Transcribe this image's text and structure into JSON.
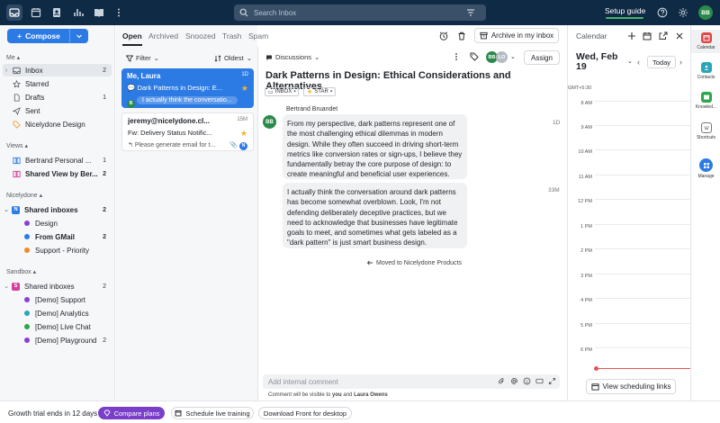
{
  "topbar": {
    "search_placeholder": "Search Inbox",
    "setup_guide": "Setup guide",
    "user_initials": "BB"
  },
  "sidebar": {
    "compose_label": "Compose",
    "me_header": "Me",
    "me_items": [
      {
        "label": "Inbox",
        "count": "2",
        "icon": "inbox-icon"
      },
      {
        "label": "Starred",
        "count": "",
        "icon": "star-icon"
      },
      {
        "label": "Drafts",
        "count": "1",
        "icon": "draft-icon"
      },
      {
        "label": "Sent",
        "count": "",
        "icon": "send-icon"
      },
      {
        "label": "Nicelydone Design",
        "count": "",
        "icon": "tag-icon"
      }
    ],
    "views_header": "Views",
    "views_items": [
      {
        "label": "Bertrand Personal ...",
        "count": "1"
      },
      {
        "label": "Shared View by Ber...",
        "count": "2"
      }
    ],
    "team_header": "Nicelydone",
    "team_items": [
      {
        "label": "Shared inboxes",
        "count": "2"
      },
      {
        "label": "Design",
        "count": "",
        "color": "#8b3fd1"
      },
      {
        "label": "From GMail",
        "count": "2",
        "color": "#2c7be5"
      },
      {
        "label": "Support - Priority",
        "count": "",
        "color": "#f08a24"
      }
    ],
    "sandbox_header": "Sandbox",
    "sandbox_items": [
      {
        "label": "Shared inboxes",
        "count": "2"
      },
      {
        "label": "[Demo] Support",
        "count": "",
        "color": "#8b3fd1"
      },
      {
        "label": "[Demo] Analytics",
        "count": "",
        "color": "#2aa6b8"
      },
      {
        "label": "[Demo] Live Chat",
        "count": "",
        "color": "#2aa84a"
      },
      {
        "label": "[Demo] Playground",
        "count": "2",
        "color": "#8b3fd1"
      }
    ]
  },
  "list": {
    "tabs": [
      "Open",
      "Archived",
      "Snoozed",
      "Trash",
      "Spam"
    ],
    "filter_label": "Filter",
    "sort_label": "Oldest",
    "conversations": [
      {
        "from": "Me, Laura",
        "time": "1D",
        "subject": "Dark Patterns in Design: E...",
        "preview": "I actually think the conversatio..."
      },
      {
        "from": "jeremy@nicelydone.cl...",
        "time": "15M",
        "subject": "Fw: Delivery Status Notific...",
        "preview": "Please generate email for t..."
      }
    ]
  },
  "message": {
    "discussions_label": "Discussions",
    "assign_label": "Assign",
    "archive_label": "Archive in my inbox",
    "subject": "Dark Patterns in Design: Ethical Considerations and Alternatives",
    "tags": [
      "INBOX",
      "STAR"
    ],
    "sender_name": "Bertrand Bruandet",
    "sender_initials": "BB",
    "assignee_initials": [
      "BB",
      "LO"
    ],
    "messages": [
      {
        "time": "1D",
        "body": "From my perspective, dark patterns represent one of the most challenging ethical dilemmas in modern design. While they often succeed in driving short-term metrics like conversion rates or sign-ups, I believe they fundamentally betray the core purpose of design: to create meaningful and beneficial user experiences."
      },
      {
        "time": "33M",
        "body": "I actually think the conversation around dark patterns has become somewhat overblown. Look, I'm not defending deliberately deceptive practices, but we need to acknowledge that businesses have legitimate goals to meet, and sometimes what gets labeled as a \"dark pattern\" is just smart business design."
      }
    ],
    "moved_note": "Moved to Nicelydone Products",
    "comment_placeholder": "Add internal comment",
    "comment_note_prefix": "Comment will be visible to",
    "comment_note_you": "you",
    "comment_note_and": "and",
    "comment_note_person": "Laura Owens"
  },
  "calendar": {
    "title": "Calendar",
    "date": "Wed, Feb 19",
    "today_label": "Today",
    "timezone": "GMT+5:30",
    "hours": [
      "8 AM",
      "9 AM",
      "10 AM",
      "11 AM",
      "12 PM",
      "1 PM",
      "2 PM",
      "3 PM",
      "4 PM",
      "5 PM",
      "6 PM"
    ],
    "scheduling_label": "View scheduling links"
  },
  "rail": {
    "items": [
      "Calendar",
      "Contacts",
      "Knowled...",
      "Shortcuts",
      "Manage"
    ]
  },
  "bottombar": {
    "trial": "Growth trial ends in 12 days",
    "compare": "Compare plans",
    "schedule": "Schedule live training",
    "download": "Download Front for desktop"
  }
}
